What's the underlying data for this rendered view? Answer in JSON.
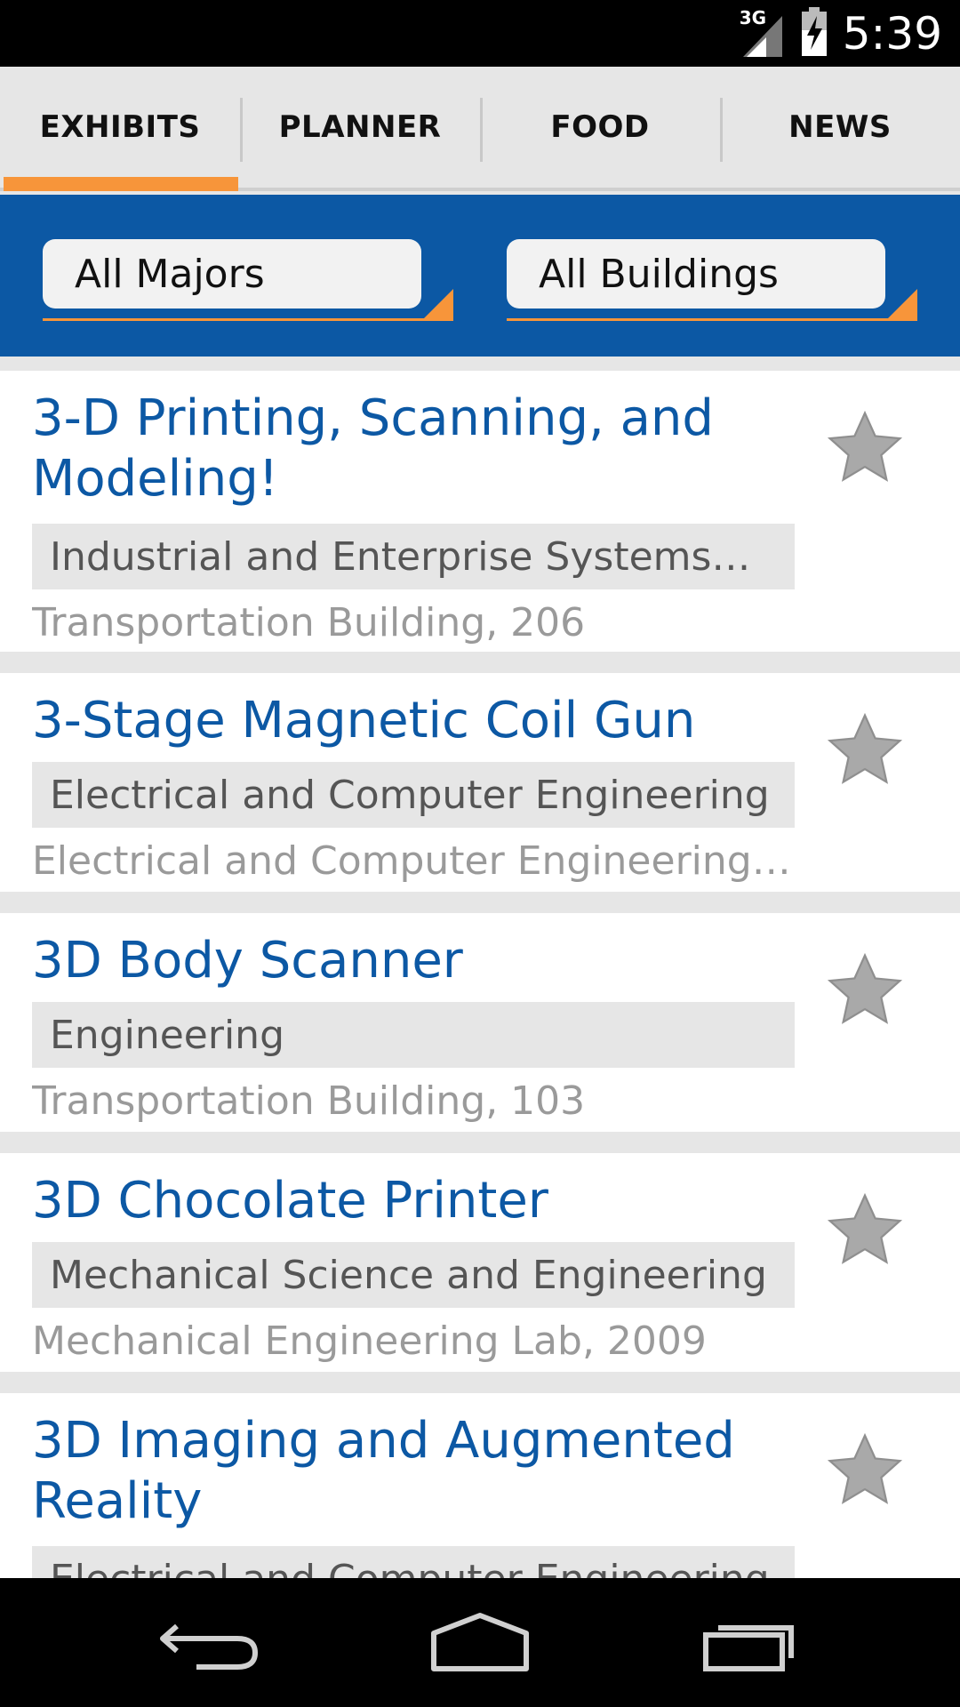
{
  "status_bar": {
    "time": "5:39",
    "network": "3G",
    "icons": [
      "signal-icon",
      "battery-charging-icon"
    ]
  },
  "tabs": [
    {
      "label": "EXHIBITS",
      "active": true
    },
    {
      "label": "PLANNER",
      "active": false
    },
    {
      "label": "FOOD",
      "active": false
    },
    {
      "label": "NEWS",
      "active": false
    }
  ],
  "filters": {
    "major": "All Majors",
    "building": "All Buildings"
  },
  "exhibits": [
    {
      "title": "3-D Printing, Scanning, and Modeling!",
      "major": "Industrial and Enterprise Systems…",
      "location": "Transportation Building, 206",
      "starred": false
    },
    {
      "title": "3-Stage Magnetic Coil Gun",
      "major": "Electrical and Computer Engineering",
      "location": "Electrical and Computer Engineering…",
      "starred": false
    },
    {
      "title": "3D Body Scanner",
      "major": "Engineering",
      "location": "Transportation Building, 103",
      "starred": false
    },
    {
      "title": "3D Chocolate Printer",
      "major": "Mechanical Science and Engineering",
      "location": "Mechanical Engineering Lab, 2009",
      "starred": false
    },
    {
      "title": "3D Imaging and Augmented Reality",
      "major": "Electrical and Computer Engineering",
      "location": "",
      "starred": false
    }
  ],
  "nav": {
    "back": "back-icon",
    "home": "home-icon",
    "recents": "recents-icon"
  },
  "colors": {
    "accent": "#f7953a",
    "brand_blue": "#0c58a4",
    "title_blue": "#0c58a4"
  }
}
